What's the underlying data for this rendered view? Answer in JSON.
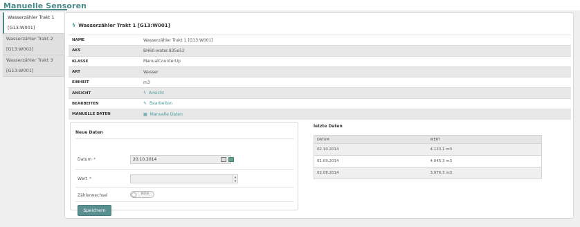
{
  "page": {
    "title": "Manuelle Sensoren"
  },
  "tabs": [
    {
      "line1": "Wasserzähler Trakt 1",
      "line2": "[G13:W001]",
      "active": true
    },
    {
      "line1": "Wasserzähler Trakt 2",
      "line2": "[G13:W002]",
      "active": false
    },
    {
      "line1": "Wasserzähler Trakt 3",
      "line2": "[G13:W001]",
      "active": false
    }
  ],
  "section": {
    "title": "Wasserzähler Trakt 1 [G13:W001]",
    "icon": "bolt-icon"
  },
  "info": {
    "name": {
      "label": "NAME",
      "value": "Wasserzähler Trakt 1 [G13:W001]"
    },
    "aks": {
      "label": "AKS",
      "value": "BH60-water.835e52"
    },
    "klasse": {
      "label": "KLASSE",
      "value": "ManualCounterUp"
    },
    "art": {
      "label": "ART",
      "value": "Wasser"
    },
    "einheit": {
      "label": "EINHEIT",
      "value": "m3"
    },
    "ansicht": {
      "label": "ANSICHT",
      "value": "Ansicht",
      "icon": "bolt-icon"
    },
    "bearbeiten": {
      "label": "BEARBEITEN",
      "value": "Bearbeiten",
      "icon": "edit-icon"
    },
    "manuelle": {
      "label": "MANUELLE DATEN",
      "value": "Manuelle Daten",
      "icon": "table-icon"
    }
  },
  "form": {
    "title": "Neue Daten",
    "datum_label": "Datum",
    "datum_value": "20.10.2014",
    "wert_label": "Wert",
    "wert_value": "",
    "required_mark": "*",
    "zaehler_label": "Zählerwechsel",
    "toggle_text": "NEIN",
    "save_label": "Speichern"
  },
  "last": {
    "title": "letzte Daten",
    "columns": [
      "DATUM",
      "WERT"
    ],
    "rows": [
      {
        "datum": "02.10.2014",
        "wert": "4.123,1 m3"
      },
      {
        "datum": "01.09.2014",
        "wert": "4.045,3 m3"
      },
      {
        "datum": "02.08.2014",
        "wert": "3.976,3 m3"
      }
    ]
  },
  "colors": {
    "accent": "#4a8a8a",
    "button": "#5a8f8f",
    "link": "#4a9a9a"
  }
}
